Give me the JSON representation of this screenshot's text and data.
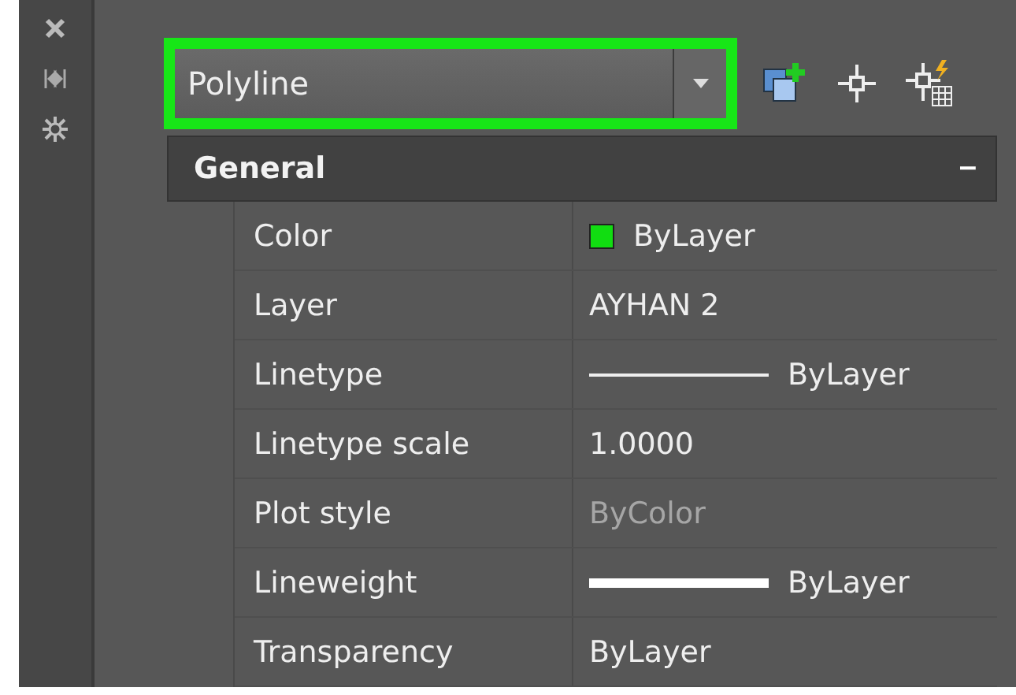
{
  "side_toolbar": {
    "buttons": [
      {
        "kind": "close"
      },
      {
        "kind": "auto-hide"
      },
      {
        "kind": "settings"
      }
    ]
  },
  "object_select": {
    "value": "Polyline",
    "highlighted": true
  },
  "toolbar": {
    "buttons": [
      {
        "kind": "toggle-pickadd"
      },
      {
        "kind": "select-objects"
      },
      {
        "kind": "quick-select"
      }
    ]
  },
  "section": {
    "title": "General",
    "expanded": true,
    "toggle": "–"
  },
  "properties": [
    {
      "label": "Color",
      "value": "ByLayer",
      "kind": "color",
      "color": "#11dd11",
      "disabled": false
    },
    {
      "label": "Layer",
      "value": "AYHAN 2",
      "kind": "text",
      "disabled": false
    },
    {
      "label": "Linetype",
      "value": "ByLayer",
      "kind": "linetype",
      "disabled": false
    },
    {
      "label": "Linetype scale",
      "value": "1.0000",
      "kind": "text",
      "disabled": false
    },
    {
      "label": "Plot style",
      "value": "ByColor",
      "kind": "text",
      "disabled": true
    },
    {
      "label": "Lineweight",
      "value": "ByLayer",
      "kind": "lineweight",
      "disabled": false
    },
    {
      "label": "Transparency",
      "value": "ByLayer",
      "kind": "text",
      "disabled": false
    }
  ]
}
